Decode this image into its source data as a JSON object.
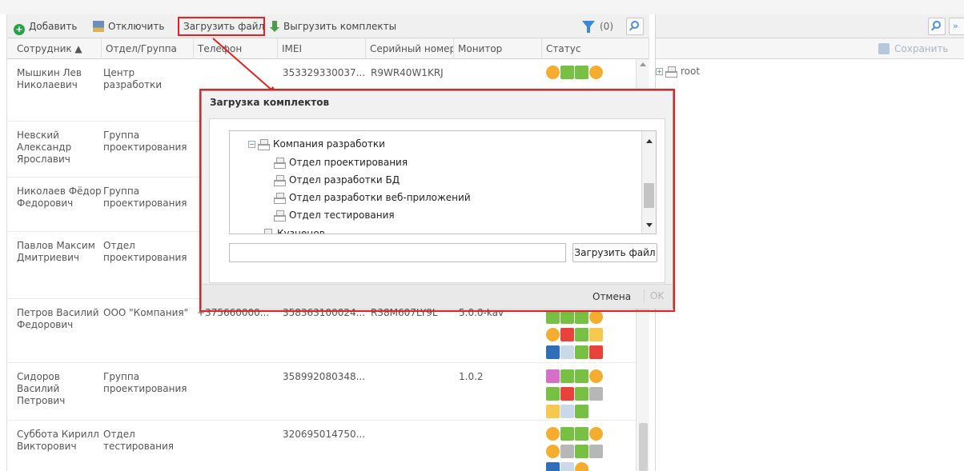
{
  "toolbar": {
    "add_label": "Добавить",
    "disable_label": "Отключить",
    "upload_label": "Загрузить файл",
    "download_label": "Выгрузить комплекты",
    "filter_count": "(0)"
  },
  "table": {
    "columns": [
      "Сотрудник ▲",
      "Отдел/Группа",
      "Телефон",
      "IMEI",
      "Серийный номер.",
      "Монитор",
      "Статус"
    ],
    "rows": [
      {
        "employee": "Мышкин Лев Николаевич",
        "department": "Центр разработки",
        "phone": "",
        "imei": "353329330037...",
        "serial": "R9WR40W1KRJ",
        "monitor": ""
      },
      {
        "employee": "Невский Александр Ярославич",
        "department": "Группа проектирования",
        "phone": "",
        "imei": "",
        "serial": "",
        "monitor": ""
      },
      {
        "employee": "Николаев Фёдор Федорович",
        "department": "Группа проектирования",
        "phone": "",
        "imei": "",
        "serial": "",
        "monitor": ""
      },
      {
        "employee": "Павлов Максим Дмитриевич",
        "department": "Отдел проектирования",
        "phone": "",
        "imei": "",
        "serial": "",
        "monitor": ""
      },
      {
        "employee": "Петров Василий Федорович",
        "department": "ООО \"Компания\"",
        "phone": "+375660000...",
        "imei": "358363100024...",
        "serial": "R38M607LY9L",
        "monitor": "5.0.0-kav"
      },
      {
        "employee": "Сидоров Василий Петрович",
        "department": "Группа проектирования",
        "phone": "",
        "imei": "358992080348...",
        "serial": "",
        "monitor": "1.0.2"
      },
      {
        "employee": "Суббота Кирилл Викторович",
        "department": "Отдел тестирования",
        "phone": "",
        "imei": "320695014750...",
        "serial": "",
        "monitor": ""
      }
    ]
  },
  "right_panel": {
    "save_label": "Сохранить",
    "more_label": "»",
    "tree_root": "root"
  },
  "dialog": {
    "title": "Загрузка комплектов",
    "tree": [
      "Компания разработки",
      "Отдел проектирования",
      "Отдел разработки БД",
      "Отдел разработки веб-приложений",
      "Отдел тестирования",
      "Кузнецов"
    ],
    "file_value": "",
    "upload_button": "Загрузить файл",
    "cancel_button": "Отмена",
    "ok_button": "OK"
  },
  "colors": {
    "highlight": "#e32221",
    "filter_icon": "#3b88d8",
    "status_green": "#77c043",
    "status_orange": "#f4ad2f",
    "status_red": "#e8423a",
    "status_blue": "#2f6fb8"
  }
}
